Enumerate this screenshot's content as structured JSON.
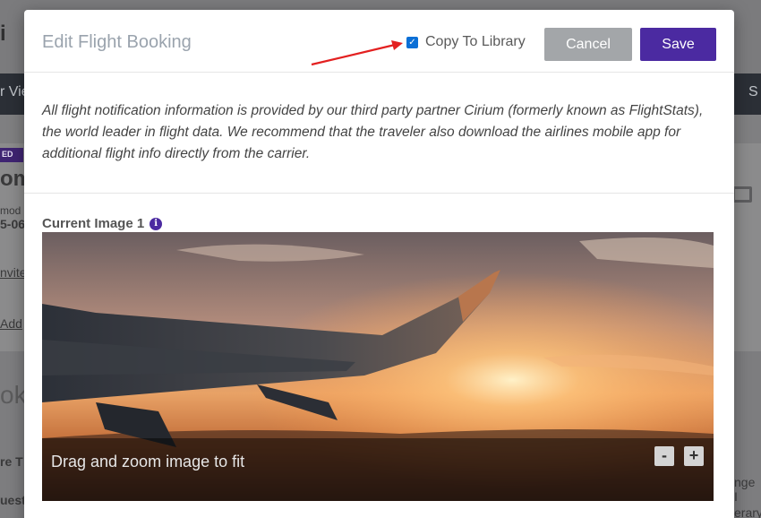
{
  "background": {
    "letter": "i",
    "nav_left": "r Vie",
    "nav_right": "S",
    "badge": "ED",
    "title_frag": "om",
    "sub_frag": "mod",
    "date_frag": "5-06",
    "link_invite": "nvite",
    "link_add": "Add",
    "section_frag": "ok",
    "row1": "re T",
    "row2": "uest",
    "right1": "nge I",
    "right2": "erary"
  },
  "modal": {
    "title": "Edit Flight Booking",
    "copy_to_library": {
      "label": "Copy To Library",
      "checked": true
    },
    "cancel_label": "Cancel",
    "save_label": "Save",
    "notice": "All flight notification information is provided by our third party partner Cirium (formerly known as FlightStats), the world leader in flight data. We recommend that the traveler also download the airlines mobile app for additional flight info directly from the carrier.",
    "current_image_label": "Current Image 1",
    "info_icon": "i",
    "image_hint": "Drag and zoom image to fit",
    "zoom_out_label": "-",
    "zoom_in_label": "+"
  },
  "colors": {
    "accent": "#4b2aa1",
    "cancel": "#a3a6a9",
    "annotation_arrow": "#e32020"
  },
  "icons": [
    "info-icon",
    "checkbox-checked-icon",
    "zoom-out-icon",
    "zoom-in-icon",
    "annotation-arrow-icon"
  ]
}
